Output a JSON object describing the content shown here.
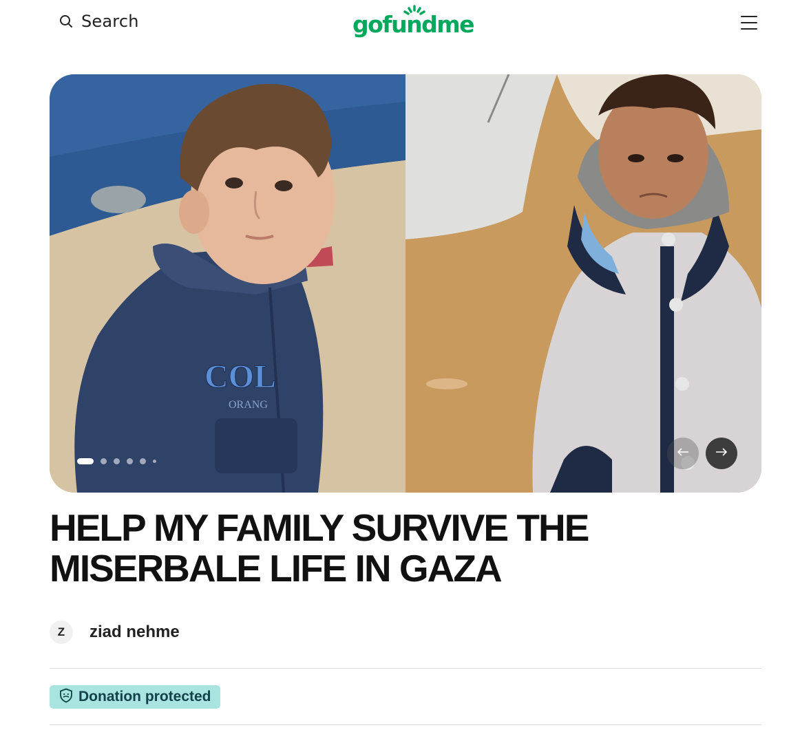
{
  "header": {
    "search_label": "Search",
    "logo_text": "gofundme",
    "search_icon": "search-icon",
    "menu_icon": "hamburger-menu-icon"
  },
  "hero": {
    "carousel": {
      "slide_count": 6,
      "active_slide": 1
    },
    "prev_icon": "arrow-left-icon",
    "next_icon": "arrow-right-icon"
  },
  "campaign": {
    "title": "HELP MY FAMILY SURVIVE THE MISERBALE LIFE IN GAZA",
    "organizer": {
      "initial": "Z",
      "name": "ziad nehme"
    },
    "badge": {
      "label": "Donation protected",
      "icon": "shield-icon"
    }
  },
  "colors": {
    "brand": "#02a95c",
    "badge_bg": "#a9e4e0",
    "badge_text": "#12414a"
  }
}
